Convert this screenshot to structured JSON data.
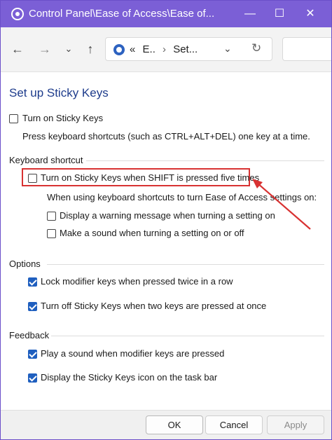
{
  "window": {
    "title": "Control Panel\\Ease of Access\\Ease of...",
    "controls": {
      "minimize": "—",
      "maximize": "☐",
      "close": "✕"
    }
  },
  "nav": {
    "back": "←",
    "forward": "→",
    "recent": "⌄",
    "up": "↑",
    "address": {
      "part1": "«",
      "part2": "E..",
      "part3": "Set...",
      "separator": "›"
    },
    "dropdown": "⌄",
    "refresh": "↻"
  },
  "page": {
    "title": "Set up Sticky Keys"
  },
  "main_option": {
    "label": "Turn on Sticky Keys",
    "checked": false,
    "description": "Press keyboard shortcuts (such as CTRL+ALT+DEL) one key at a time."
  },
  "keyboard_shortcut": {
    "group_title": "Keyboard shortcut",
    "shift_five": {
      "label": "Turn on Sticky Keys when SHIFT is pressed five times",
      "checked": false
    },
    "note": "When using keyboard shortcuts to turn Ease of Access settings on:",
    "warning": {
      "label": "Display a warning message when turning a setting on",
      "checked": false
    },
    "sound": {
      "label": "Make a sound when turning a setting on or off",
      "checked": false
    }
  },
  "options": {
    "group_title": "Options",
    "lock_modifier": {
      "label": "Lock modifier keys when pressed twice in a row",
      "checked": true
    },
    "turn_off": {
      "label": "Turn off Sticky Keys when two keys are pressed at once",
      "checked": true
    }
  },
  "feedback": {
    "group_title": "Feedback",
    "play_sound": {
      "label": "Play a sound when modifier keys are pressed",
      "checked": true
    },
    "display_icon": {
      "label": "Display the Sticky Keys icon on the task bar",
      "checked": true
    }
  },
  "buttons": {
    "ok": "OK",
    "cancel": "Cancel",
    "apply": "Apply"
  },
  "colors": {
    "titlebar": "#7b5fd6",
    "accent": "#1f5fbf",
    "highlight": "#d83232",
    "heading": "#1e3c8c"
  }
}
